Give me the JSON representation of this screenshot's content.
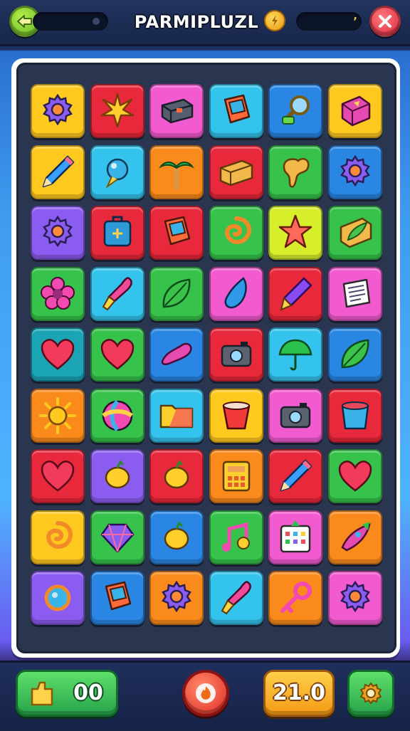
{
  "header": {
    "title": "PARMIPLUZL",
    "coin_value": "’",
    "back_icon": "back-arrow-icon",
    "close_icon": "close-icon",
    "coin_icon": "coin-icon"
  },
  "footer": {
    "score_value": "00",
    "score_icon": "trophy-icon",
    "moves_value": "21.0",
    "play_icon": "fire-icon",
    "settings_icon": "gear-icon"
  },
  "colors": {
    "yellow": "#ffc91f",
    "red": "#e8283b",
    "pink": "#f15bcf",
    "cyan": "#34c3ec",
    "blue": "#2a86e3",
    "orange": "#fb8a1d",
    "green": "#36c24b",
    "purple": "#8b5cf0",
    "lime": "#d6ef2a",
    "teal": "#1aa4b4"
  },
  "tiles": [
    {
      "bg": "yellow",
      "icon": "gear-icon"
    },
    {
      "bg": "red",
      "icon": "starburst-icon"
    },
    {
      "bg": "pink",
      "icon": "box-icon"
    },
    {
      "bg": "cyan",
      "icon": "book-icon"
    },
    {
      "bg": "blue",
      "icon": "magnifier-icon"
    },
    {
      "bg": "yellow",
      "icon": "gift-box-icon"
    },
    {
      "bg": "yellow",
      "icon": "pencil-icon"
    },
    {
      "bg": "cyan",
      "icon": "bubble-icon"
    },
    {
      "bg": "orange",
      "icon": "palm-tree-icon"
    },
    {
      "bg": "red",
      "icon": "crate-icon"
    },
    {
      "bg": "green",
      "icon": "blob-icon"
    },
    {
      "bg": "blue",
      "icon": "gear-icon"
    },
    {
      "bg": "purple",
      "icon": "gear-icon"
    },
    {
      "bg": "red",
      "icon": "suitcase-icon"
    },
    {
      "bg": "red",
      "icon": "book-icon"
    },
    {
      "bg": "green",
      "icon": "swirl-icon"
    },
    {
      "bg": "lime",
      "icon": "star-icon"
    },
    {
      "bg": "green",
      "icon": "leaf-box-icon"
    },
    {
      "bg": "green",
      "icon": "flower-icon"
    },
    {
      "bg": "cyan",
      "icon": "brush-icon"
    },
    {
      "bg": "green",
      "icon": "leaf-icon"
    },
    {
      "bg": "pink",
      "icon": "drop-icon"
    },
    {
      "bg": "red",
      "icon": "crayon-icon"
    },
    {
      "bg": "pink",
      "icon": "note-icon"
    },
    {
      "bg": "teal",
      "icon": "heart-icon"
    },
    {
      "bg": "green",
      "icon": "heart-icon"
    },
    {
      "bg": "blue",
      "icon": "bean-icon"
    },
    {
      "bg": "red",
      "icon": "camera-icon"
    },
    {
      "bg": "cyan",
      "icon": "umbrella-icon"
    },
    {
      "bg": "blue",
      "icon": "leaf-icon"
    },
    {
      "bg": "orange",
      "icon": "sun-icon"
    },
    {
      "bg": "green",
      "icon": "swirl-ball-icon"
    },
    {
      "bg": "cyan",
      "icon": "folder-icon"
    },
    {
      "bg": "yellow",
      "icon": "cup-icon"
    },
    {
      "bg": "pink",
      "icon": "camera-icon"
    },
    {
      "bg": "red",
      "icon": "bucket-icon"
    },
    {
      "bg": "red",
      "icon": "heart-icon"
    },
    {
      "bg": "purple",
      "icon": "lemon-icon"
    },
    {
      "bg": "red",
      "icon": "lemon-icon"
    },
    {
      "bg": "orange",
      "icon": "calculator-icon"
    },
    {
      "bg": "red",
      "icon": "pencil-icon"
    },
    {
      "bg": "green",
      "icon": "heart-icon"
    },
    {
      "bg": "yellow",
      "icon": "swirl-icon"
    },
    {
      "bg": "green",
      "icon": "gem-icon"
    },
    {
      "bg": "blue",
      "icon": "lemon-icon"
    },
    {
      "bg": "green",
      "icon": "music-icon"
    },
    {
      "bg": "pink",
      "icon": "calendar-icon"
    },
    {
      "bg": "orange",
      "icon": "rocket-icon"
    },
    {
      "bg": "purple",
      "icon": "ring-icon"
    },
    {
      "bg": "blue",
      "icon": "book-icon"
    },
    {
      "bg": "orange",
      "icon": "gear-icon"
    },
    {
      "bg": "cyan",
      "icon": "brush-icon"
    },
    {
      "bg": "orange",
      "icon": "key-icon"
    },
    {
      "bg": "pink",
      "icon": "gear-icon"
    }
  ]
}
